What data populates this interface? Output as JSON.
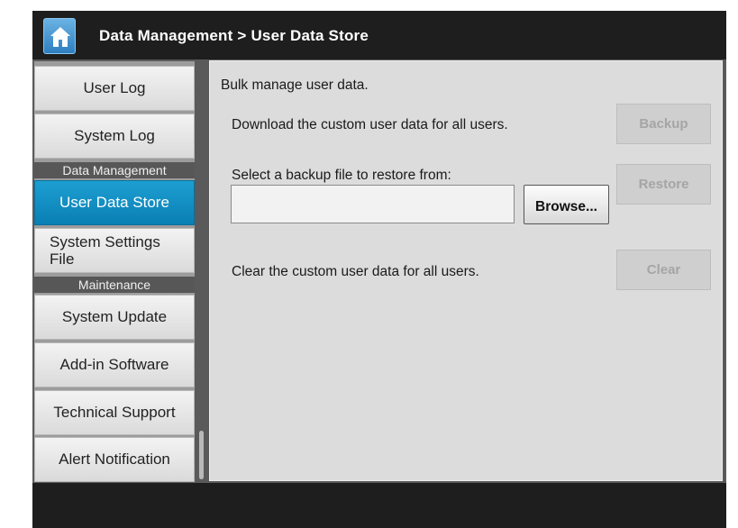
{
  "header": {
    "title": "Data Management > User Data Store",
    "home_icon": "home-icon"
  },
  "sidebar": {
    "items": [
      {
        "label": "User Log"
      },
      {
        "label": "System Log"
      },
      {
        "section": "Data Management"
      },
      {
        "label": "User Data Store",
        "active": true
      },
      {
        "label": "System Settings File"
      },
      {
        "section": "Maintenance"
      },
      {
        "label": "System Update"
      },
      {
        "label": "Add-in Software"
      },
      {
        "label": "Technical Support"
      },
      {
        "label": "Alert Notification"
      }
    ]
  },
  "main": {
    "intro": "Bulk manage user data.",
    "backup": {
      "text": "Download the custom user data for all users.",
      "button": "Backup"
    },
    "restore": {
      "text": "Select a backup file to restore from:",
      "file_value": "",
      "browse_button": "Browse...",
      "button": "Restore"
    },
    "clear": {
      "text": "Clear the custom user data for all users.",
      "button": "Clear"
    }
  },
  "colors": {
    "header_bg": "#1e1e1e",
    "active_item": "#0a8fc4",
    "section_bg": "#575757",
    "content_bg": "#dcdcdc"
  }
}
